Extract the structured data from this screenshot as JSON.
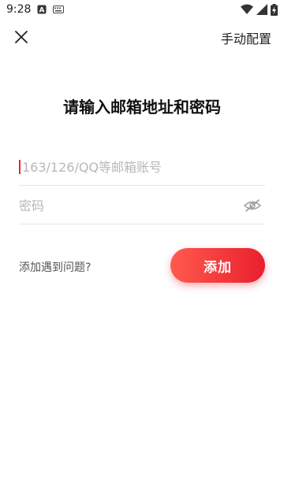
{
  "status_bar": {
    "time": "9:28",
    "icons": [
      "a-badge-icon",
      "keyboard-icon",
      "wifi-icon",
      "signal-icon",
      "battery-charging-icon"
    ]
  },
  "top_bar": {
    "close_icon": "close-icon",
    "manual_config_label": "手动配置"
  },
  "title": "请输入邮箱地址和密码",
  "form": {
    "account": {
      "value": "",
      "placeholder": "163/126/QQ等邮箱账号"
    },
    "password": {
      "value": "",
      "placeholder": "密码",
      "toggle_icon": "eye-off-icon"
    }
  },
  "help_link": "添加遇到问题?",
  "add_button": "添加",
  "colors": {
    "accent": "#e91f2e",
    "accent_light": "#ff5a4e",
    "placeholder": "#b8b8b8",
    "divider": "#e6e6e6"
  }
}
